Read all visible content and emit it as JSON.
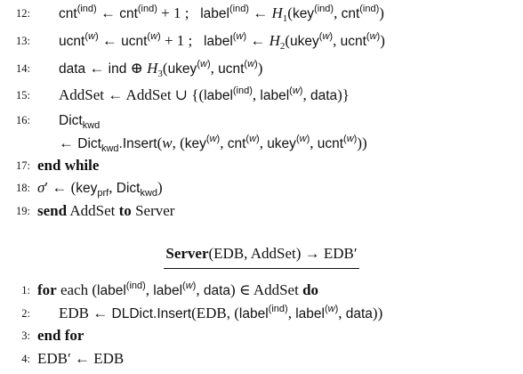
{
  "top": {
    "l12": {
      "num": "12:",
      "text": "cnt(ind) ← cnt(ind) + 1 ;   label(ind) ← H1(key(ind), cnt(ind))"
    },
    "l13": {
      "num": "13:",
      "text": "ucnt(w) ← ucnt(w) + 1 ;   label(w) ← H2(ukey(w), ucnt(w))"
    },
    "l14": {
      "num": "14:",
      "text": "data ← ind ⊕ H3(ukey(w), ucnt(w))"
    },
    "l15": {
      "num": "15:",
      "text": "AddSet ← AddSet ∪ {(label(ind), label(w), data)}"
    },
    "l16": {
      "num": "16:",
      "text": "Dictkwd"
    },
    "l16b": {
      "text": "← Dictkwd.Insert(w, (key(w), cnt(w), ukey(w), ucnt(w)))"
    },
    "l17": {
      "num": "17:",
      "kw": "end while"
    },
    "l18": {
      "num": "18:",
      "text": "σ′ ← (keyprf, Dictkwd)"
    },
    "l19": {
      "num": "19:",
      "kw_send": "send",
      "mid": "AddSet",
      "kw_to": "to",
      "end": "Server"
    }
  },
  "server": {
    "title_bold": "Server",
    "title_rest": "(EDB, AddSet) → EDB′",
    "l1": {
      "num": "1:",
      "kw_for": "for",
      "text": "each (label(ind), label(w), data) ∈ AddSet",
      "kw_do": "do"
    },
    "l2": {
      "num": "2:",
      "text": "EDB ← DLDict.Insert(EDB, (label(ind), label(w), data))"
    },
    "l3": {
      "num": "3:",
      "kw": "end for"
    },
    "l4": {
      "num": "4:",
      "text": "EDB′ ← EDB"
    }
  }
}
